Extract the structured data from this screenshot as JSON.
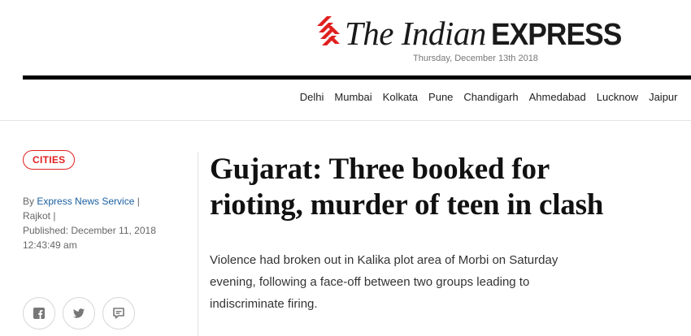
{
  "masthead": {
    "logo_the": "The Indian",
    "logo_express": "EXPRESS",
    "date": "Thursday, December 13th 2018",
    "brand_color": "#e02020"
  },
  "city_nav": [
    "Delhi",
    "Mumbai",
    "Kolkata",
    "Pune",
    "Chandigarh",
    "Ahmedabad",
    "Lucknow",
    "Jaipur"
  ],
  "article": {
    "section": "CITIES",
    "byline_prefix": "By",
    "author": "Express News Service",
    "sep": "|",
    "location": "Rajkot |",
    "published": "Published: December 11, 2018 12:43:49 am",
    "headline": "Gujarat: Three booked for rioting, murder of teen in clash",
    "synopsis": "Violence had broken out in Kalika plot area of Morbi on Saturday evening, following a face-off between two groups leading to indiscriminate firing."
  },
  "share": {
    "icons": [
      "facebook-icon",
      "twitter-icon",
      "comment-icon"
    ]
  }
}
